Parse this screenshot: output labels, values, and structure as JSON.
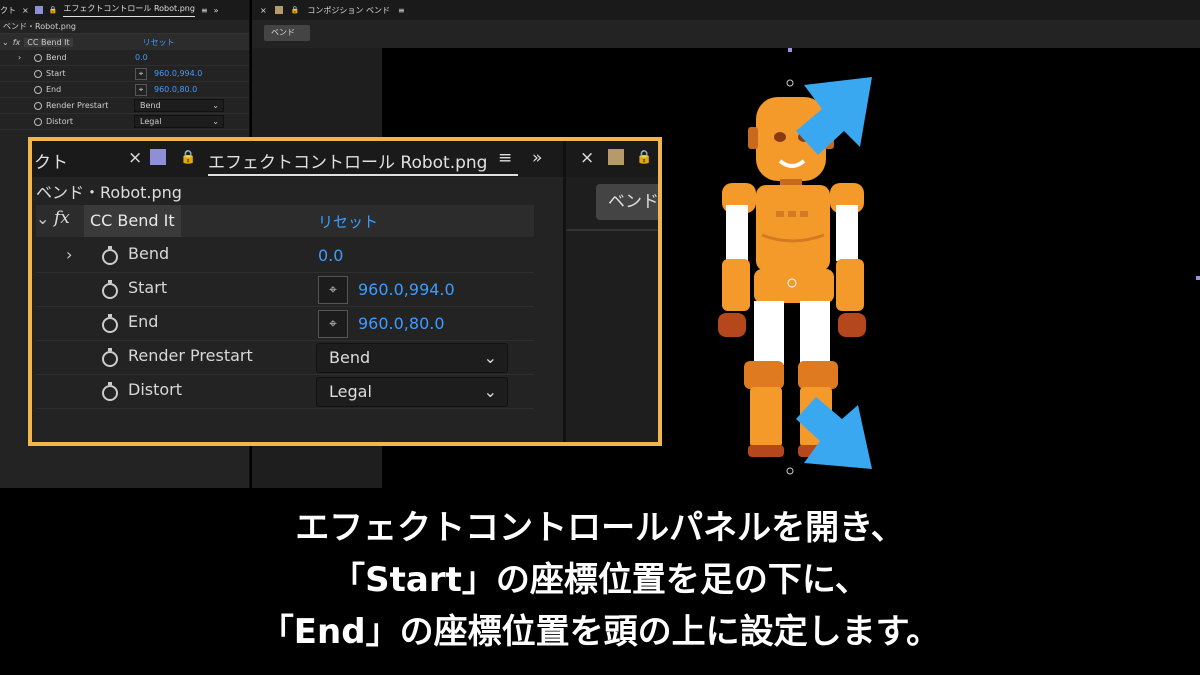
{
  "small_panel": {
    "tab_left_fragment": "クト",
    "tab_close": "×",
    "tab_lock": "🔒",
    "tab_title": "エフェクトコントロール Robot.png",
    "tab_menu": "≡",
    "tab_more": "»",
    "layer_title": "ベンド・Robot.png",
    "effect_chevron": "⌄",
    "effect_fx": "fx",
    "effect_name": "CC Bend It",
    "reset_label": "リセット",
    "params": [
      {
        "expand": "›",
        "name": "Bend",
        "value": "0.0"
      },
      {
        "name": "Start",
        "target": "⌖",
        "value": "960.0,994.0"
      },
      {
        "name": "End",
        "target": "⌖",
        "value": "960.0,80.0"
      },
      {
        "name": "Render Prestart",
        "dropdown": "Bend",
        "chevron": "⌄"
      },
      {
        "name": "Distort",
        "dropdown": "Legal",
        "chevron": "⌄"
      }
    ]
  },
  "comp_panel": {
    "close": "×",
    "lock": "🔒",
    "title": "コンポジション ベンド",
    "menu": "≡",
    "tab_button": "ベンド"
  },
  "callout": {
    "tab_left_fragment": "クト",
    "tab_close": "×",
    "tab_lock": "🔒",
    "tab_title": "エフェクトコントロール Robot.png",
    "tab_menu": "≡",
    "tab_more": "»",
    "right_close": "×",
    "right_lock": "🔒",
    "right_button": "ベンド",
    "layer_title": "ベンド・Robot.png",
    "effect_chevron": "⌄",
    "effect_fx": "fx",
    "effect_name": "CC Bend It",
    "reset_label": "リセット",
    "params": [
      {
        "expand": "›",
        "name": "Bend",
        "value": "0.0"
      },
      {
        "name": "Start",
        "target": "⌖",
        "value": "960.0,994.0"
      },
      {
        "name": "End",
        "target": "⌖",
        "value": "960.0,80.0"
      },
      {
        "name": "Render Prestart",
        "dropdown": "Bend",
        "chevron": "⌄"
      },
      {
        "name": "Distort",
        "dropdown": "Legal",
        "chevron": "⌄"
      }
    ]
  },
  "caption": {
    "line1": "エフェクトコントロールパネルを開き、",
    "line2": "「Start」の座標位置を足の下に、",
    "line3": "「End」の座標位置を頭の上に設定します。"
  },
  "colors": {
    "accent_blue": "#3d9cff",
    "callout_border": "#f2b64e",
    "arrow_blue": "#3aa8f0",
    "robot_orange": "#f39a2b",
    "small_panel_square": "#8f8fd6",
    "comp_panel_square": "#b59a6a"
  },
  "icons": {
    "stopwatch": "stopwatch-icon",
    "target": "crosshair-target-icon",
    "lock": "lock-icon",
    "menu": "hamburger-menu-icon",
    "arrows": "arrow-pointer-icon"
  }
}
